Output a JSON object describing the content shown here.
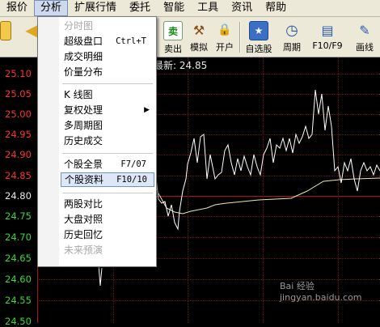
{
  "menubar": {
    "items": [
      {
        "label": "报价"
      },
      {
        "label": "分析"
      },
      {
        "label": "扩展行情"
      },
      {
        "label": "委托"
      },
      {
        "label": "智能"
      },
      {
        "label": "工具"
      },
      {
        "label": "资讯"
      },
      {
        "label": "帮助"
      }
    ]
  },
  "toolbar": {
    "buttons": [
      {
        "label": "卖出",
        "icon": "sell-icon",
        "glyph": "卖"
      },
      {
        "label": "模拟",
        "icon": "gavel-icon",
        "glyph": "⚒"
      },
      {
        "label": "开户",
        "icon": "lock-icon",
        "glyph": "🔒"
      },
      {
        "label": "自选股",
        "icon": "star-list-icon",
        "glyph": "★"
      },
      {
        "label": "周期",
        "icon": "clock-icon",
        "glyph": "◷"
      },
      {
        "label": "F10/F9",
        "icon": "f10-icon",
        "glyph": "▤"
      },
      {
        "label": "画线",
        "icon": "pencil-icon",
        "glyph": "✎"
      }
    ]
  },
  "chart": {
    "latest_label": "最新: 24.85",
    "price_axis": [
      "25.10",
      "25.05",
      "25.00",
      "24.95",
      "24.90",
      "24.85",
      "24.80",
      "24.75",
      "24.70",
      "24.65",
      "24.60",
      "24.55",
      "24.50"
    ],
    "colors": {
      "up": "#ff3030",
      "down": "#33dd33",
      "neutral": "#e8e8e8",
      "grid": "#6e1414"
    }
  },
  "menu": {
    "items": [
      {
        "label": "分时图",
        "shortcut": "",
        "disabled": true
      },
      {
        "label": "超级盘口",
        "shortcut": "Ctrl+T"
      },
      {
        "label": "成交明细",
        "shortcut": ""
      },
      {
        "label": "价量分布",
        "shortcut": ""
      },
      {
        "label": "K 线图",
        "shortcut": ""
      },
      {
        "label": "复权处理",
        "shortcut": "",
        "submenu": true
      },
      {
        "label": "多周期图",
        "shortcut": ""
      },
      {
        "label": "历史成交",
        "shortcut": ""
      },
      {
        "label": "个股全景",
        "shortcut": "F7/07"
      },
      {
        "label": "个股资料",
        "shortcut": "F10/10",
        "highlighted": true
      },
      {
        "label": "两股对比",
        "shortcut": ""
      },
      {
        "label": "大盘对照",
        "shortcut": ""
      },
      {
        "label": "历史回忆",
        "shortcut": ""
      },
      {
        "label": "未来预演",
        "shortcut": "",
        "disabled": true
      }
    ]
  },
  "watermark": "Bai 经验 jingyan.baidu.com"
}
